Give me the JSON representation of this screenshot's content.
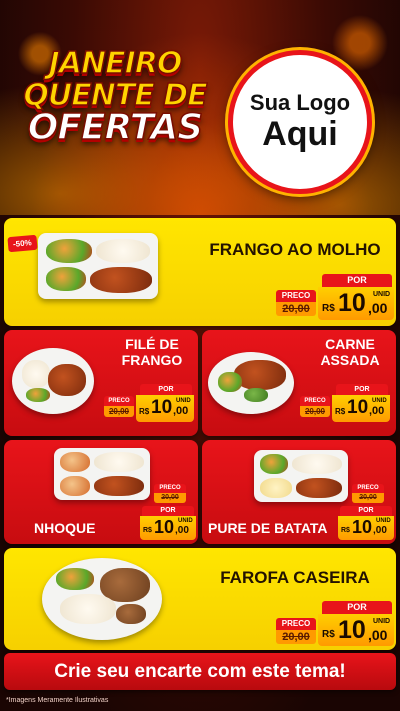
{
  "header": {
    "headline_line1": "JANEIRO",
    "headline_line2": "QUENTE DE",
    "headline_line3": "OFERTAS",
    "logo_line1": "Sua Logo",
    "logo_line2": "Aqui"
  },
  "discount_badge": "-50%",
  "price_labels": {
    "old_label": "PRECO",
    "new_label": "POR",
    "currency": "R$",
    "unit": "UNID"
  },
  "items": [
    {
      "name": "FRANGO AO MOLHO",
      "old_price": "20,00",
      "price_int": "10",
      "price_dec": ",00"
    },
    {
      "name": "FILÉ DE FRANGO",
      "old_price": "20,00",
      "price_int": "10",
      "price_dec": ",00"
    },
    {
      "name": "CARNE ASSADA",
      "old_price": "20,00",
      "price_int": "10",
      "price_dec": ",00"
    },
    {
      "name": "NHOQUE",
      "old_price": "20,00",
      "price_int": "10",
      "price_dec": ",00"
    },
    {
      "name": "PURE DE BATATA",
      "old_price": "20,00",
      "price_int": "10",
      "price_dec": ",00"
    },
    {
      "name": "FAROFA CASEIRA",
      "old_price": "20,00",
      "price_int": "10",
      "price_dec": ",00"
    }
  ],
  "cta": "Crie seu encarte com este tema!",
  "footnote": "*Imagens Meramente Ilustrativas",
  "colors": {
    "primary_red": "#e8141a",
    "yellow": "#ffe600",
    "orange": "#ff9a00"
  }
}
